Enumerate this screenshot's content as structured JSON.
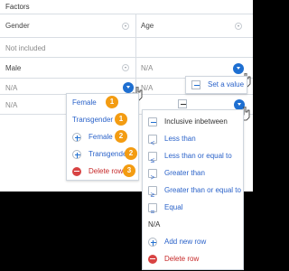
{
  "table": {
    "title": "Factors",
    "columns": [
      {
        "label": "Gender"
      },
      {
        "label": "Age"
      }
    ],
    "rows": [
      [
        "Not included",
        ""
      ],
      [
        "Male",
        "N/A"
      ],
      [
        "N/A",
        "N/A"
      ],
      [
        "N/A",
        ""
      ]
    ]
  },
  "left_menu": {
    "items": [
      {
        "label": "Female",
        "badge": "1"
      },
      {
        "label": "Transgender",
        "badge": "1"
      },
      {
        "label": "Female",
        "badge": "2"
      },
      {
        "label": "Transgender",
        "badge": "2"
      },
      {
        "label": "Delete row",
        "badge": "3"
      }
    ]
  },
  "set_value_menu": {
    "label": "Set a value"
  },
  "age_menu": {
    "items": [
      "Inclusive inbetween",
      "Less than",
      "Less than or equal to",
      "Greater than",
      "Greater than or equal to",
      "Equal",
      "N/A",
      "Add new row",
      "Delete row"
    ]
  },
  "colors": {
    "accent": "#1e6fd1",
    "badge": "#f39c12",
    "delete": "#c62828",
    "divider": "#d8dde3"
  },
  "icons": {
    "column_filter": "chevron-down-icon",
    "cell_action": "chevron-down-icon",
    "minus": "minus-icon",
    "plus": "plus-icon",
    "delete": "delete-icon",
    "lt": "less-than-icon",
    "lte": "less-than-or-equal-icon",
    "gt": "greater-than-icon",
    "gte": "greater-than-or-equal-icon",
    "eq": "equal-icon",
    "cursor": "cursor-hand-icon"
  }
}
